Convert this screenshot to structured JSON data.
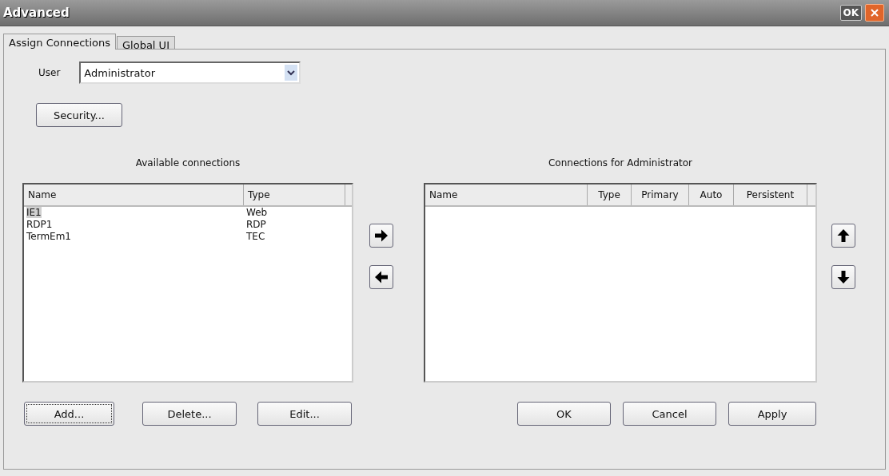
{
  "window": {
    "title": "Advanced",
    "ok_label": "OK"
  },
  "tabs": [
    {
      "label": "Assign Connections",
      "selected": true
    },
    {
      "label": "Global UI",
      "selected": false
    }
  ],
  "user": {
    "label": "User",
    "value": "Administrator"
  },
  "security_button": "Security...",
  "available": {
    "title": "Available connections",
    "columns": [
      "Name",
      "Type"
    ],
    "rows": [
      {
        "cells": [
          "IE1",
          "Web"
        ],
        "selected": true
      },
      {
        "cells": [
          "RDP1",
          "RDP"
        ],
        "selected": false
      },
      {
        "cells": [
          "TermEm1",
          "TEC"
        ],
        "selected": false
      }
    ]
  },
  "assigned": {
    "title": "Connections for Administrator",
    "columns": [
      "Name",
      "Type",
      "Primary",
      "Auto",
      "Persistent"
    ]
  },
  "left_buttons": [
    {
      "label": "Add...",
      "focused": true
    },
    {
      "label": "Delete...",
      "focused": false
    },
    {
      "label": "Edit...",
      "focused": false
    }
  ],
  "right_buttons": [
    "OK",
    "Cancel",
    "Apply"
  ]
}
